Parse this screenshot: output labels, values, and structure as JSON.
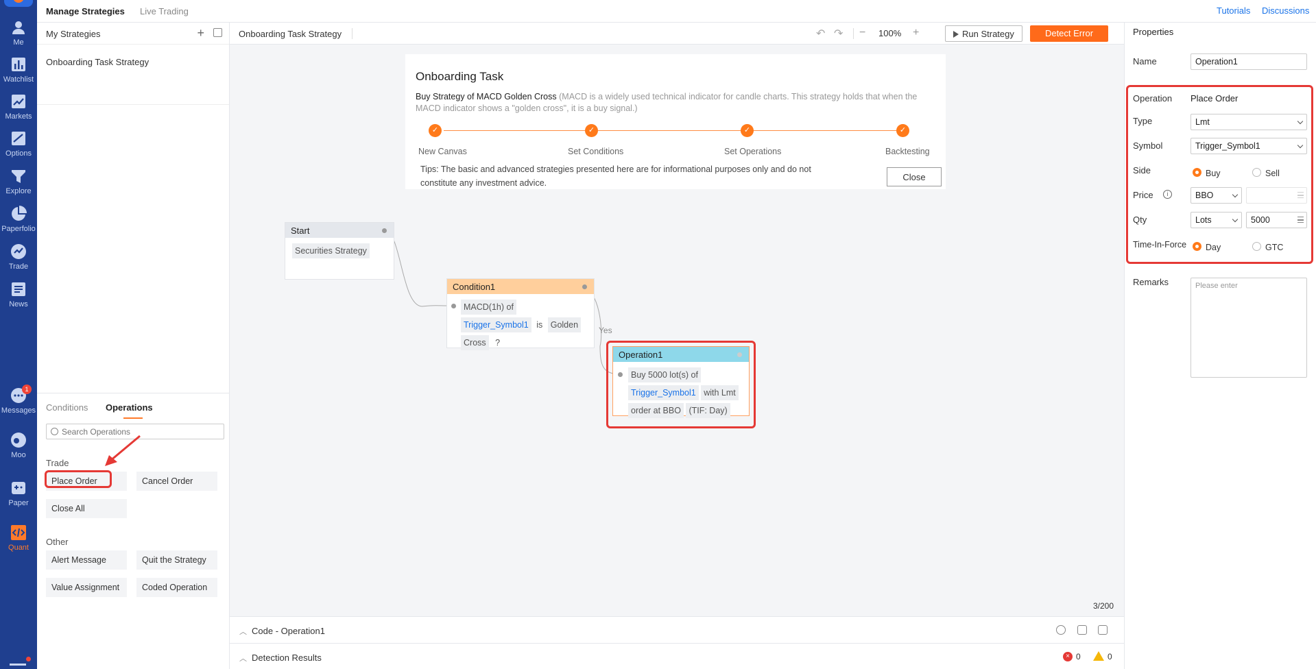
{
  "nav": {
    "items": [
      {
        "label": "Me",
        "icon": "user-icon"
      },
      {
        "label": "Watchlist",
        "icon": "bar-chart-icon"
      },
      {
        "label": "Markets",
        "icon": "trend-chart-icon"
      },
      {
        "label": "Options",
        "icon": "options-icon"
      },
      {
        "label": "Explore",
        "icon": "funnel-icon"
      },
      {
        "label": "Paperfolio",
        "icon": "pie-chart-icon"
      },
      {
        "label": "Trade",
        "icon": "trade-icon"
      },
      {
        "label": "News",
        "icon": "news-icon"
      },
      {
        "label": "Messages",
        "icon": "message-icon",
        "badge": "1"
      },
      {
        "label": "Moo",
        "icon": "moo-icon"
      },
      {
        "label": "Paper",
        "icon": "gamepad-icon"
      },
      {
        "label": "Quant",
        "icon": "code-icon"
      }
    ],
    "active": "Quant",
    "accent": "#ff7a2a",
    "background": "#1f3f8f"
  },
  "header": {
    "tab_active": "Manage Strategies",
    "tab_inactive": "Live Trading",
    "link_tutorials": "Tutorials",
    "link_discussions": "Discussions"
  },
  "strategies": {
    "title": "My Strategies",
    "items": [
      "Onboarding Task Strategy"
    ]
  },
  "ops_panel": {
    "tab_conditions": "Conditions",
    "tab_operations": "Operations",
    "search_placeholder": "Search Operations",
    "group_trade": "Trade",
    "group_other": "Other",
    "trade_items": [
      "Place Order",
      "Cancel Order",
      "Close All"
    ],
    "other_items": [
      "Alert Message",
      "Quit the Strategy",
      "Value Assignment",
      "Coded Operation"
    ]
  },
  "toolbar": {
    "strategy_name": "Onboarding Task Strategy",
    "zoom": "100%",
    "run_label": "Run Strategy",
    "detect_label": "Detect Error"
  },
  "onboarding": {
    "title": "Onboarding Task",
    "strategy_title": "Buy Strategy of MACD Golden Cross",
    "description": "(MACD is a widely used technical indicator for candle charts. This strategy holds that when the MACD indicator shows a \"golden cross\", it is a buy signal.)",
    "steps": [
      "New Canvas",
      "Set Conditions",
      "Set Operations",
      "Backtesting"
    ],
    "tips": "Tips: The basic and advanced strategies presented here are for informational purposes only and do not constitute any investment advice.",
    "close_label": "Close"
  },
  "nodes": {
    "start": {
      "title": "Start",
      "chip": "Securities Strategy"
    },
    "condition": {
      "title": "Condition1",
      "indicator": "MACD(1h) of",
      "symbol": "Trigger_Symbol1",
      "is": "is",
      "golden": "Golden",
      "cross": "Cross",
      "q": "?"
    },
    "yes": "Yes",
    "operation": {
      "title": "Operation1",
      "line1": "Buy 5000 lot(s) of",
      "symbol": "Trigger_Symbol1",
      "with": "with Lmt",
      "line3": "order at BBO",
      "tif": "(TIF: Day)"
    }
  },
  "canvas": {
    "counter": "3/200"
  },
  "drawers": {
    "code_label": "Code - Operation1",
    "detection_label": "Detection Results",
    "errors": "0",
    "warnings": "0"
  },
  "properties": {
    "title": "Properties",
    "name_label": "Name",
    "name_value": "Operation1",
    "operation_label": "Operation",
    "operation_value": "Place Order",
    "type_label": "Type",
    "type_value": "Lmt",
    "symbol_label": "Symbol",
    "symbol_value": "Trigger_Symbol1",
    "side_label": "Side",
    "side_buy": "Buy",
    "side_sell": "Sell",
    "price_label": "Price",
    "price_value": "BBO",
    "qty_label": "Qty",
    "qty_unit": "Lots",
    "qty_value": "5000",
    "tif_label": "Time-In-Force",
    "tif_day": "Day",
    "tif_gtc": "GTC",
    "remarks_label": "Remarks",
    "remarks_placeholder": "Please enter"
  }
}
